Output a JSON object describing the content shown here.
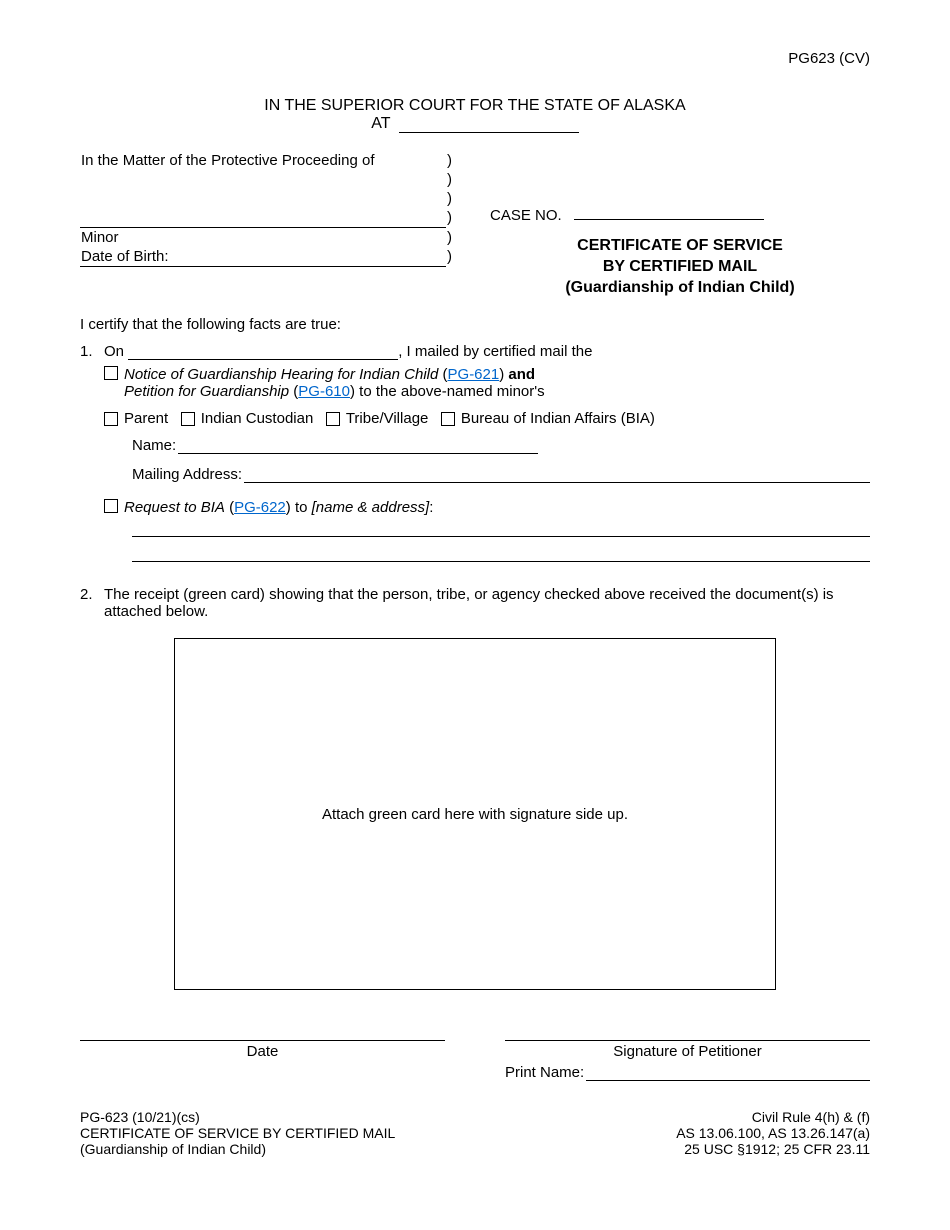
{
  "form_code_top": "PG623 (CV)",
  "court_header": "IN THE SUPERIOR COURT FOR THE STATE OF ALASKA",
  "at_label": "AT",
  "caption": {
    "matter": "In the Matter of the Protective Proceeding of",
    "minor": "Minor",
    "dob_label": "Date of Birth:"
  },
  "case_no_label": "CASE NO.",
  "title": {
    "line1": "CERTIFICATE OF SERVICE",
    "line2": "BY CERTIFIED MAIL",
    "line3": "(Guardianship of Indian Child)"
  },
  "certify_text": "I certify that the following facts are true:",
  "item1": {
    "num": "1.",
    "on": "On",
    "mailed_suffix": ", I mailed by certified mail the",
    "notice_text": "Notice of Guardianship Hearing for Indian Child",
    "notice_link": "PG-621",
    "and": "and",
    "petition_text": "Petition for Guardianship",
    "petition_link": "PG-610",
    "minor_text": "to the above-named minor's",
    "recipients": {
      "parent": "Parent",
      "custodian": "Indian Custodian",
      "tribe": "Tribe/Village",
      "bia": "Bureau of Indian Affairs (BIA)"
    },
    "name_label": "Name:",
    "addr_label": "Mailing Address:",
    "request_text": "Request to BIA",
    "request_link": "PG-622",
    "request_suffix": "to",
    "name_addr_ital": "[name & address]"
  },
  "item2": {
    "num": "2.",
    "text": "The receipt (green card) showing that the person, tribe, or agency checked above received the document(s) is attached below."
  },
  "attach_text": "Attach green card here with signature side up.",
  "sig": {
    "date": "Date",
    "petitioner": "Signature of Petitioner",
    "print_name": "Print Name:"
  },
  "footer": {
    "left1": "PG-623 (10/21)(cs)",
    "left2": "CERTIFICATE OF SERVICE BY CERTIFIED MAIL",
    "left3": "(Guardianship of Indian Child)",
    "right1": "Civil Rule 4(h) & (f)",
    "right2": "AS 13.06.100, AS 13.26.147(a)",
    "right3": "25 USC §1912; 25 CFR 23.11"
  }
}
